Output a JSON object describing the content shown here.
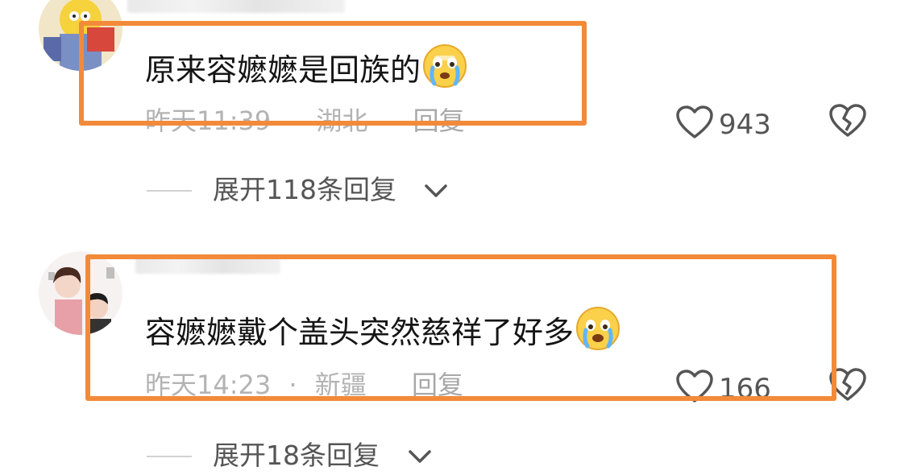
{
  "comments": [
    {
      "text": "原来容嬷嬷是回族的",
      "emoji": "crying-face-emoji",
      "time": "昨天11:39",
      "location": "湖北",
      "reply_label": "回复",
      "likes": "943",
      "expand_label": "展开118条回复"
    },
    {
      "text": "容嬷嬷戴个盖头突然慈祥了好多",
      "emoji": "crying-face-emoji",
      "time": "昨天14:23",
      "separator": "·",
      "location": "新疆",
      "reply_label": "回复",
      "likes": "166",
      "expand_label": "展开18条回复"
    }
  ],
  "colors": {
    "highlight": "#f28a3a",
    "meta_text": "#b3b3b3",
    "count_text": "#555555"
  },
  "icons": [
    "heart-outline-icon",
    "broken-heart-icon",
    "chevron-down-icon"
  ]
}
